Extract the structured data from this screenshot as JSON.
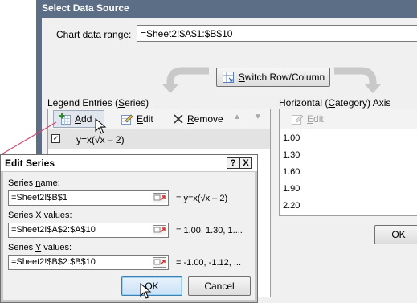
{
  "select_data_source": {
    "title": "Select Data Source",
    "chart_range_label": "Chart data range:",
    "chart_range_value": "=Sheet2!$A$1:$B$10",
    "switch_button": {
      "pre": "",
      "u": "S",
      "post": "witch Row/Column"
    },
    "legend_label": {
      "pre": "Legend Entries (",
      "u": "S",
      "post": "eries)"
    },
    "horizontal_label": {
      "pre": "Horizontal (",
      "u": "C",
      "post": "ategory) Axis Labels"
    },
    "legend_toolbar": {
      "add": {
        "u": "A",
        "post": "dd"
      },
      "edit": {
        "u": "E",
        "post": "dit"
      },
      "remove": {
        "u": "R",
        "post": "emove"
      }
    },
    "horizontal_toolbar": {
      "edit": {
        "u": "E",
        "post": "dit"
      }
    },
    "series": [
      {
        "checked": true,
        "name": "y=x(√x – 2)"
      }
    ],
    "categories": [
      "1.00",
      "1.30",
      "1.60",
      "1.90",
      "2.20"
    ],
    "ok_label": "OK"
  },
  "edit_series": {
    "title": "Edit Series",
    "help_label": "?",
    "close_label": "X",
    "series_name": {
      "label_pre": "Series ",
      "label_u": "n",
      "label_post": "ame:",
      "input": "=Sheet2!$B$1",
      "preview": "= y=x(√x – 2)"
    },
    "x_values": {
      "label_pre": "Series ",
      "label_u": "X",
      "label_post": " values:",
      "input": "=Sheet2!$A$2:$A$10",
      "preview": "= 1.00, 1.30, 1...."
    },
    "y_values": {
      "label_pre": "Series ",
      "label_u": "Y",
      "label_post": " values:",
      "input": "=Sheet2!$B$2:$B$10",
      "preview": "= -1.00, -1.12, ..."
    },
    "ok_label": "OK",
    "cancel_label": "Cancel"
  },
  "colors": {
    "title_bar": "#5c6e85",
    "dialog_bg": "#f0f0f0",
    "callout_line": "#d04a78",
    "ok_default_border": "#3c7fb1"
  }
}
